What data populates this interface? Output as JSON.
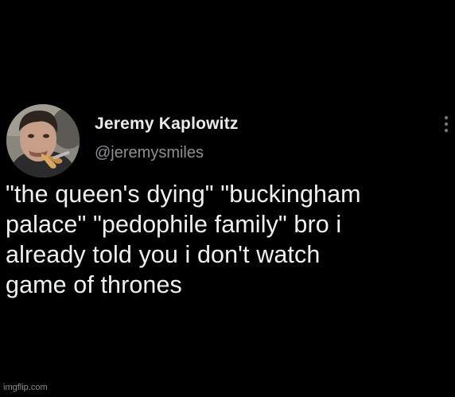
{
  "tweet": {
    "author": {
      "display_name": "Jeremy Kaplowitz",
      "handle": "@jeremysmiles",
      "avatar_icon": "profile-photo"
    },
    "more_icon": "more-options-vertical-dots-icon",
    "text": "\"the queen's dying\" \"buckingham\npalace\" \"pedophile family\" bro i\nalready told you i don't watch\ngame of thrones"
  },
  "watermark": "imgflip.com",
  "colors": {
    "background": "#000000",
    "name_text": "#e9eaeb",
    "handle_text": "#8b9095",
    "body_text": "#eef0f2"
  }
}
